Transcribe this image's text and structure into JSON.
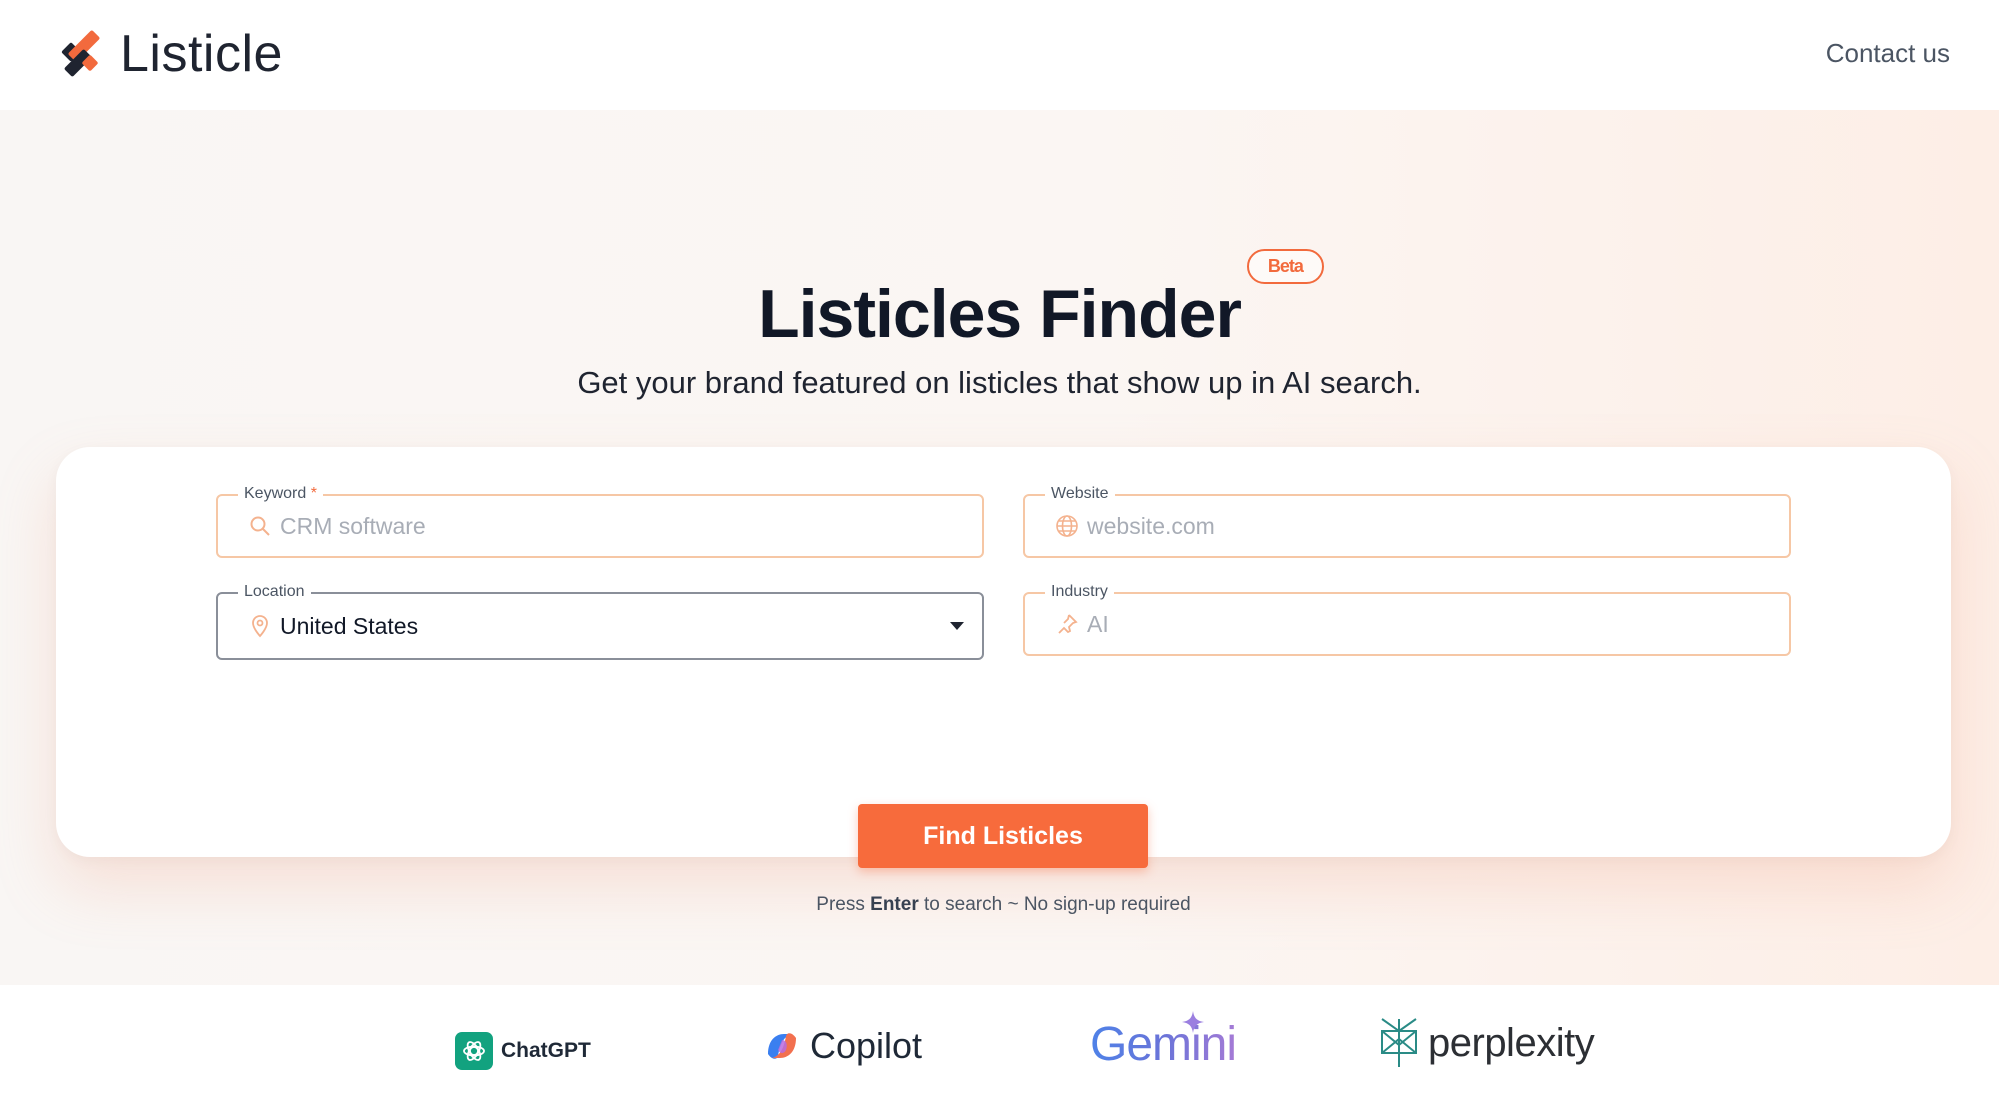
{
  "header": {
    "logo_text": "Listicle",
    "contact_label": "Contact us"
  },
  "hero": {
    "title": "Listicles Finder",
    "badge": "Beta",
    "subtitle": "Get your brand featured on listicles that show up in AI search."
  },
  "form": {
    "keyword": {
      "label": "Keyword",
      "required_mark": "*",
      "placeholder": "CRM software",
      "icon": "search-icon"
    },
    "website": {
      "label": "Website",
      "placeholder": "website.com",
      "icon": "globe-icon"
    },
    "location": {
      "label": "Location",
      "value": "United States",
      "icon": "map-pin-icon"
    },
    "industry": {
      "label": "Industry",
      "placeholder": "AI",
      "icon": "pushpin-icon"
    },
    "submit_label": "Find Listicles",
    "hint_prefix": "Press ",
    "hint_key": "Enter",
    "hint_suffix": " to search ~ No sign-up required"
  },
  "brands": [
    "ChatGPT",
    "Copilot",
    "Gemini",
    "perplexity"
  ],
  "colors": {
    "accent": "#f76b3c",
    "field_border": "#f6c7a5",
    "hero_bg": "#fbf6f3",
    "chatgpt_green": "#12a27f"
  }
}
